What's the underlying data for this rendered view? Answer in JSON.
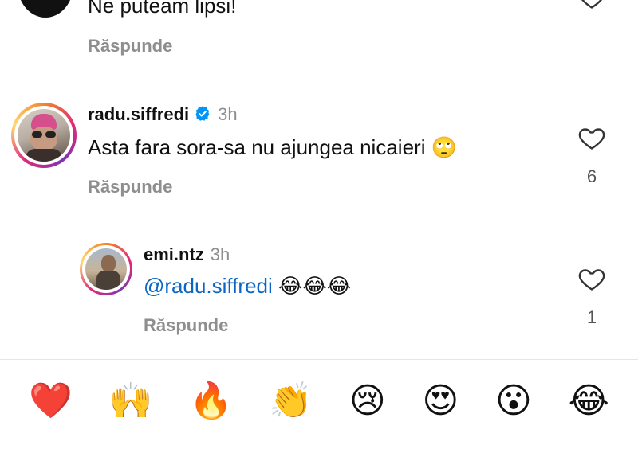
{
  "top_comment": {
    "text": "Ne puteam lipsi!",
    "reply_label": "Răspunde"
  },
  "comment1": {
    "username": "radu.siffredi",
    "time": "3h",
    "text": "Asta fara sora-sa nu ajungea nicaieri 🙄",
    "reply_label": "Răspunde",
    "likes": "6"
  },
  "comment2": {
    "username": "emi.ntz",
    "time": "3h",
    "mention": "@radu.siffredi",
    "text": " 😂😂😂",
    "reply_label": "Răspunde",
    "likes": "1"
  },
  "emoji_bar": [
    "❤️",
    "🙌",
    "🔥",
    "👏",
    "😢",
    "😍",
    "😮",
    "😂"
  ],
  "colors": {
    "mention": "#0a66c2",
    "verified": "#0095f6",
    "muted": "#8e8e8e"
  },
  "icons": {
    "like": "heart-outline-icon",
    "verified": "verified-badge-icon"
  }
}
